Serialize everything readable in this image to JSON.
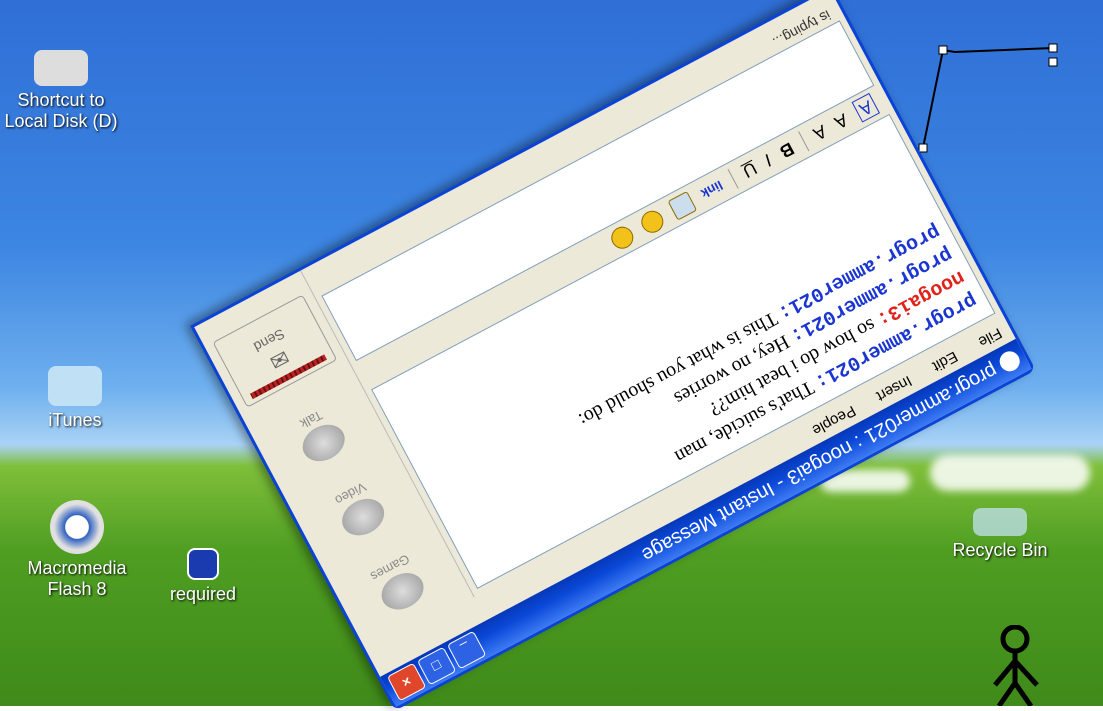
{
  "desktop": {
    "icons": [
      {
        "id": "local-disk",
        "label_line1": "Shortcut to",
        "label_line2": "Local Disk (D)"
      },
      {
        "id": "itunes",
        "label_line1": "iTunes",
        "label_line2": ""
      },
      {
        "id": "flash",
        "label_line1": "Macromedia",
        "label_line2": "Flash 8"
      },
      {
        "id": "required",
        "label_line1": "required",
        "label_line2": ""
      },
      {
        "id": "recycle",
        "label_line1": "Recycle Bin",
        "label_line2": ""
      }
    ]
  },
  "im_window": {
    "title": "progr.ammer021 : noogai3 - Instant Message",
    "menu": [
      "File",
      "Edit",
      "Insert",
      "People"
    ],
    "messages": [
      {
        "sender": "progr.ammer021:",
        "color": "blue",
        "text": "That's suicide, man"
      },
      {
        "sender": "noogai3:",
        "color": "red",
        "text": "so how do i beat him??"
      },
      {
        "sender": "progr.ammer021:",
        "color": "blue",
        "text": "Hey, no worries"
      },
      {
        "sender": "progr.ammer021:",
        "color": "blue",
        "text": "This is what you should do:"
      }
    ],
    "format_bar": {
      "bold": "B",
      "italic": "I",
      "underline": "U",
      "link": "link"
    },
    "typing_status": "is typing...",
    "tools": [
      "Talk",
      "Video",
      "Games"
    ],
    "send_label": "Send"
  }
}
